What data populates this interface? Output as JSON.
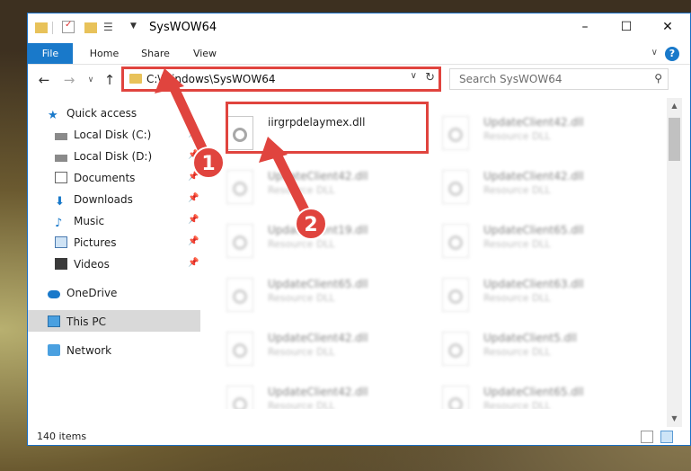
{
  "window": {
    "title": "SysWOW64"
  },
  "window_controls": {
    "minimize": "–",
    "maximize": "☐",
    "close": "✕"
  },
  "ribbon": {
    "tabs": [
      "File",
      "Home",
      "Share",
      "View"
    ],
    "help": "?"
  },
  "navigation": {
    "address": "C:\\Windows\\SysWOW64",
    "search_placeholder": "Search SysWOW64"
  },
  "sidebar": {
    "items": [
      {
        "label": "Quick access",
        "icon": "star-icon"
      },
      {
        "label": "Local Disk (C:)",
        "icon": "drive-icon"
      },
      {
        "label": "Local Disk (D:)",
        "icon": "drive-icon"
      },
      {
        "label": "Documents",
        "icon": "documents-icon"
      },
      {
        "label": "Downloads",
        "icon": "download-icon"
      },
      {
        "label": "Music",
        "icon": "music-icon"
      },
      {
        "label": "Pictures",
        "icon": "pictures-icon"
      },
      {
        "label": "Videos",
        "icon": "videos-icon"
      },
      {
        "label": "OneDrive",
        "icon": "cloud-icon"
      },
      {
        "label": "This PC",
        "icon": "computer-icon"
      },
      {
        "label": "Network",
        "icon": "network-icon"
      }
    ]
  },
  "files": [
    {
      "name": "iirgrpdelaymex.dll",
      "type": "",
      "highlighted": true
    },
    {
      "name": "UpdateClient42.dll",
      "type": "Resource DLL"
    },
    {
      "name": "UpdateClient42.dll",
      "type": "Resource DLL"
    },
    {
      "name": "UpdateClient42.dll",
      "type": "Resource DLL"
    },
    {
      "name": "UpdateClient19.dll",
      "type": "Resource DLL"
    },
    {
      "name": "UpdateClient65.dll",
      "type": "Resource DLL"
    },
    {
      "name": "UpdateClient65.dll",
      "type": "Resource DLL"
    },
    {
      "name": "UpdateClient63.dll",
      "type": "Resource DLL"
    },
    {
      "name": "UpdateClient42.dll",
      "type": "Resource DLL"
    },
    {
      "name": "UpdateClient5.dll",
      "type": "Resource DLL"
    },
    {
      "name": "UpdateClient42.dll",
      "type": "Resource DLL"
    },
    {
      "name": "UpdateClient65.dll",
      "type": "Resource DLL"
    }
  ],
  "status": {
    "item_count": "140 items"
  },
  "callouts": {
    "one": "1",
    "two": "2"
  },
  "colors": {
    "accent": "#1979ca",
    "highlight": "#e0443e",
    "folder": "#e8c25a"
  }
}
